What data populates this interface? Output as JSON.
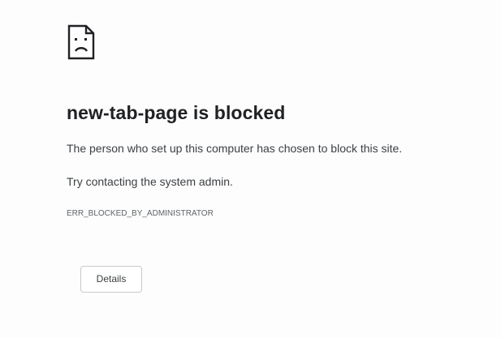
{
  "error": {
    "icon": "sad-page-icon",
    "title": "new-tab-page is blocked",
    "message_1": "The person who set up this computer has chosen to block this site.",
    "message_2": "Try contacting the system admin.",
    "code": "ERR_BLOCKED_BY_ADMINISTRATOR"
  },
  "actions": {
    "details_label": "Details"
  },
  "colors": {
    "background": "#fdfdfd",
    "text_primary": "#202124",
    "text_secondary": "#3c4043",
    "button_border": "#c8c9cc"
  }
}
